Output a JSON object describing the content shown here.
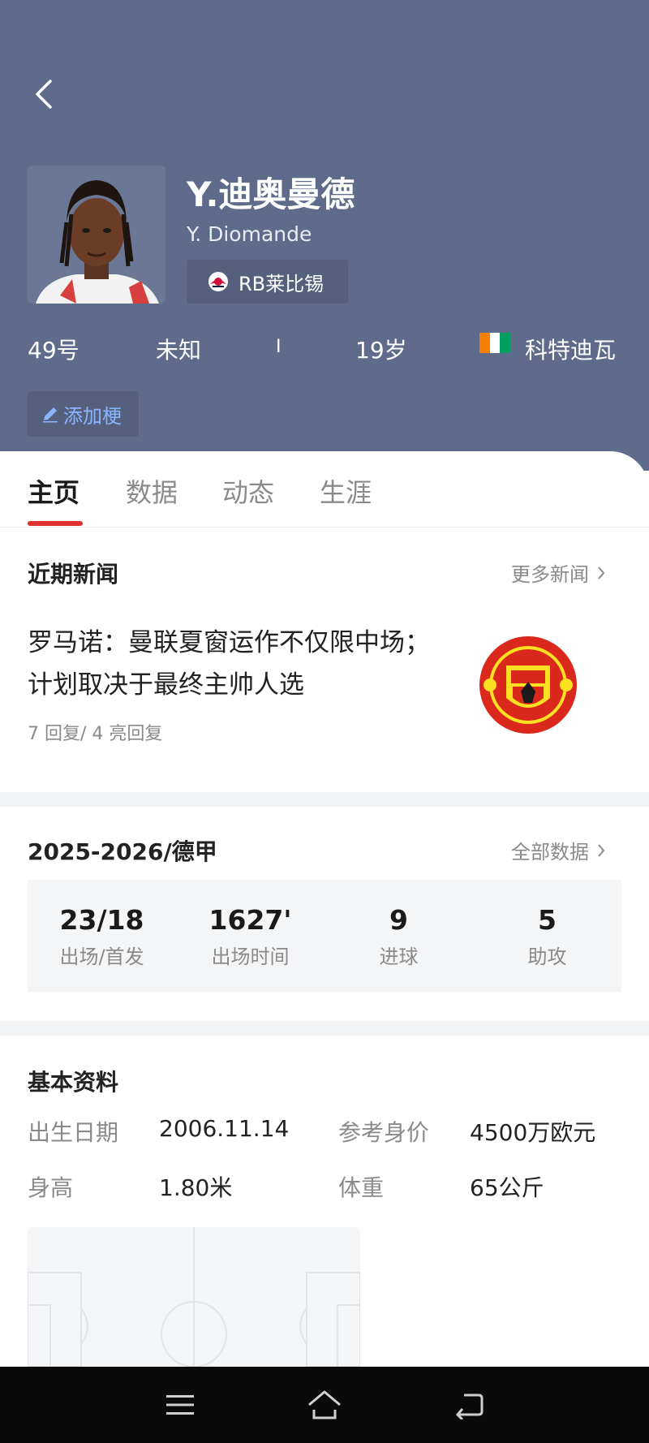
{
  "player": {
    "name_cn": "Y.迪奥曼德",
    "name_en": "Y. Diomande",
    "club": "RB莱比锡",
    "number": "49号",
    "position": "未知",
    "separator": "I",
    "age": "19岁",
    "nationality": "科特迪瓦",
    "flag_colors": [
      "#f77f00",
      "#ffffff",
      "#009e60"
    ]
  },
  "add_tag_label": "添加梗",
  "tabs": [
    {
      "label": "主页",
      "active": true
    },
    {
      "label": "数据",
      "active": false
    },
    {
      "label": "动态",
      "active": false
    },
    {
      "label": "生涯",
      "active": false
    }
  ],
  "news": {
    "section_title": "近期新闻",
    "more_label": "更多新闻",
    "item": {
      "title": "罗马诺：曼联夏窗运作不仅限中场；计划取决于最终主帅人选",
      "meta": "7 回复/ 4 亮回复",
      "thumb_icon": "manchester-united-crest-icon"
    }
  },
  "season_stats": {
    "section_title": "2025-2026/德甲",
    "more_label": "全部数据",
    "items": [
      {
        "value": "23/18",
        "label": "出场/首发"
      },
      {
        "value": "1627'",
        "label": "出场时间"
      },
      {
        "value": "9",
        "label": "进球"
      },
      {
        "value": "5",
        "label": "助攻"
      }
    ]
  },
  "basic_info": {
    "section_title": "基本资料",
    "rows": [
      {
        "k1": "出生日期",
        "v1": "2006.11.14",
        "k2": "参考身价",
        "v2": "4500万欧元"
      },
      {
        "k1": "身高",
        "v1": "1.80米",
        "k2": "体重",
        "v2": "65公斤"
      }
    ]
  },
  "colors": {
    "header_bg": "#5f6b8a",
    "accent_red": "#e03030",
    "link_blue": "#8ab4ff"
  },
  "nav_icons": [
    "menu-icon",
    "home-icon",
    "back-icon"
  ]
}
